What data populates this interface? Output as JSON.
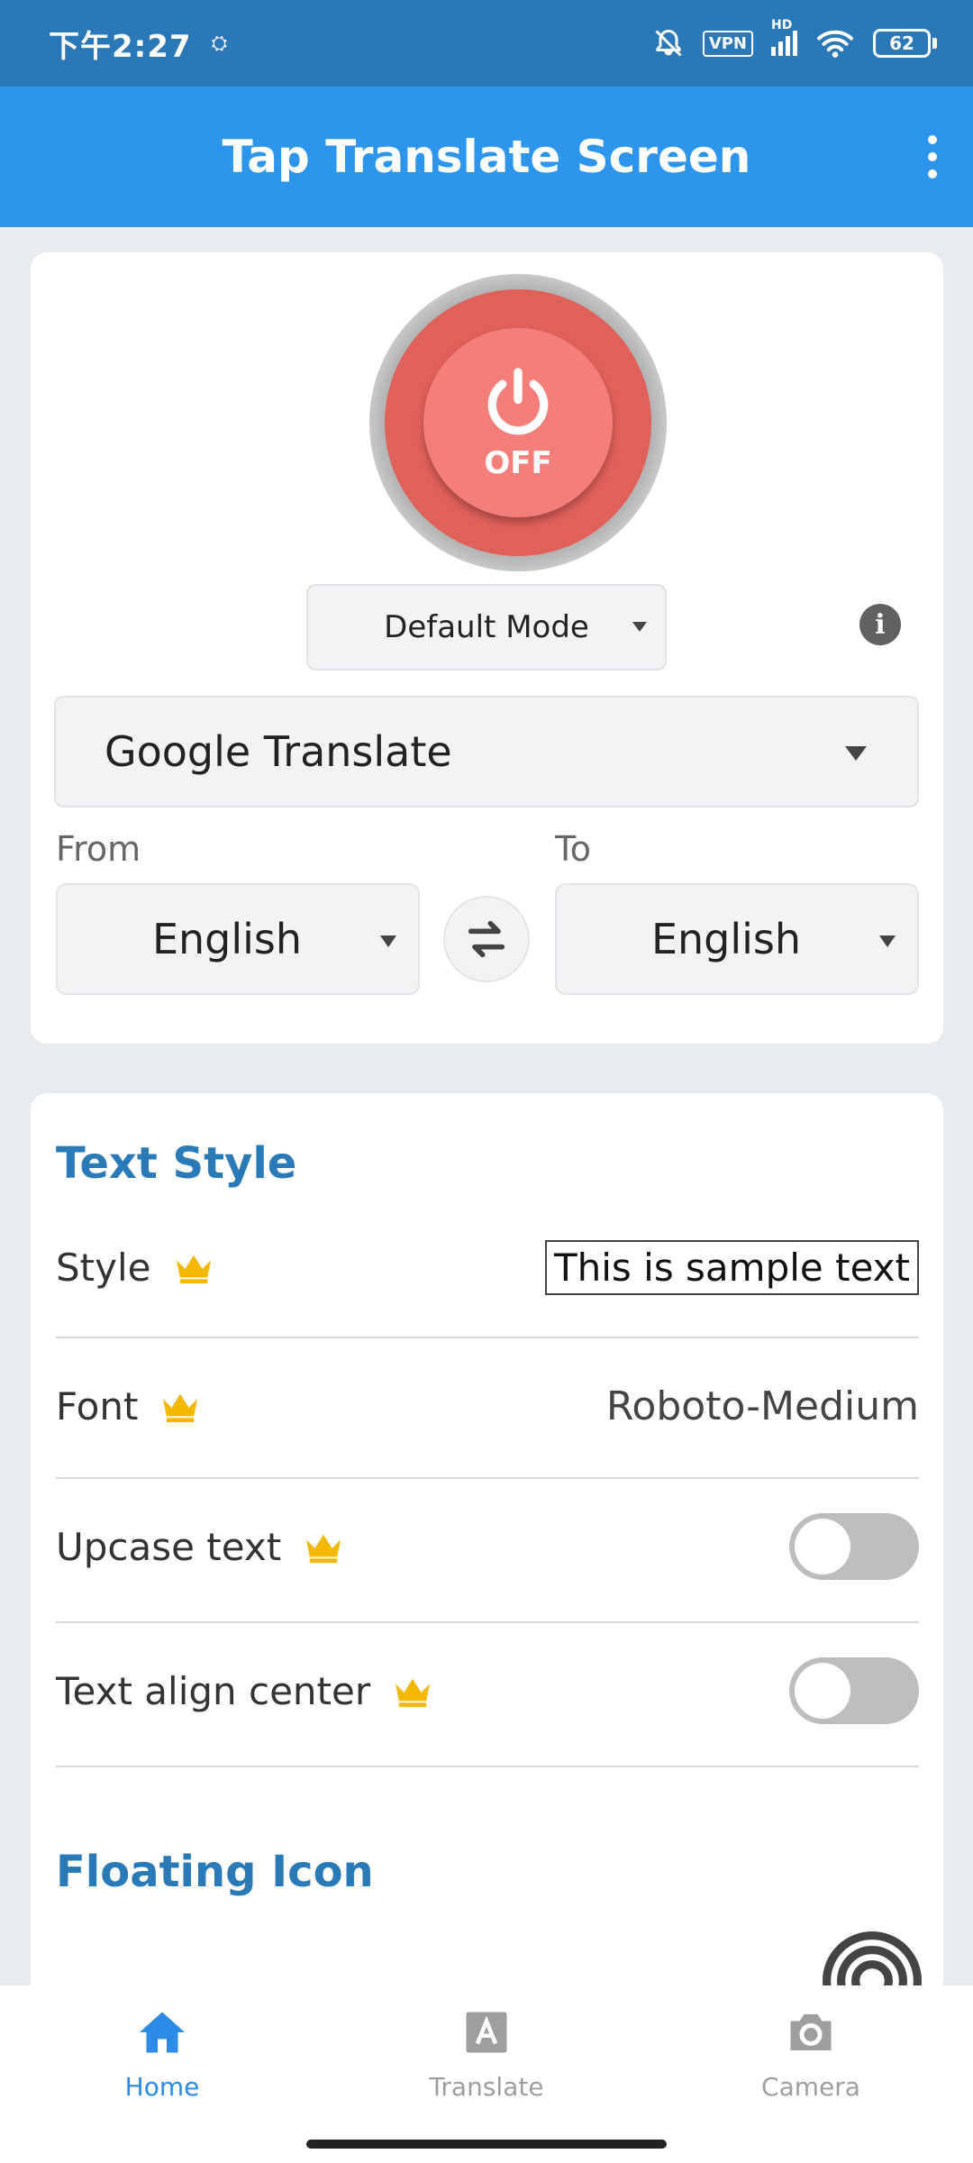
{
  "status_bar": {
    "time": "下午2:27",
    "vpn": "VPN",
    "hd": "HD",
    "battery": "62"
  },
  "app_bar": {
    "title": "Tap Translate Screen"
  },
  "power": {
    "state_label": "OFF"
  },
  "mode": {
    "selected": "Default Mode"
  },
  "engine": {
    "selected": "Google Translate"
  },
  "languages": {
    "from_label": "From",
    "from_value": "English",
    "to_label": "To",
    "to_value": "English"
  },
  "text_style": {
    "title": "Text Style",
    "style_label": "Style",
    "style_sample": "This is sample text",
    "font_label": "Font",
    "font_value": "Roboto-Medium",
    "upcase_label": "Upcase text",
    "upcase_enabled": false,
    "align_label": "Text align center",
    "align_enabled": false
  },
  "floating_icon": {
    "title": "Floating Icon"
  },
  "bottom_nav": {
    "items": [
      {
        "label": "Home",
        "icon": "home-icon",
        "active": true
      },
      {
        "label": "Translate",
        "icon": "translate-icon",
        "active": false
      },
      {
        "label": "Camera",
        "icon": "camera-icon",
        "active": false
      }
    ]
  },
  "colors": {
    "status_bar": "#2b78b8",
    "app_bar": "#2d95ec",
    "power_button": "#f47f7a",
    "section_title": "#2a7ab8",
    "crown": "#f5b800",
    "nav_active": "#2d8ae6"
  }
}
